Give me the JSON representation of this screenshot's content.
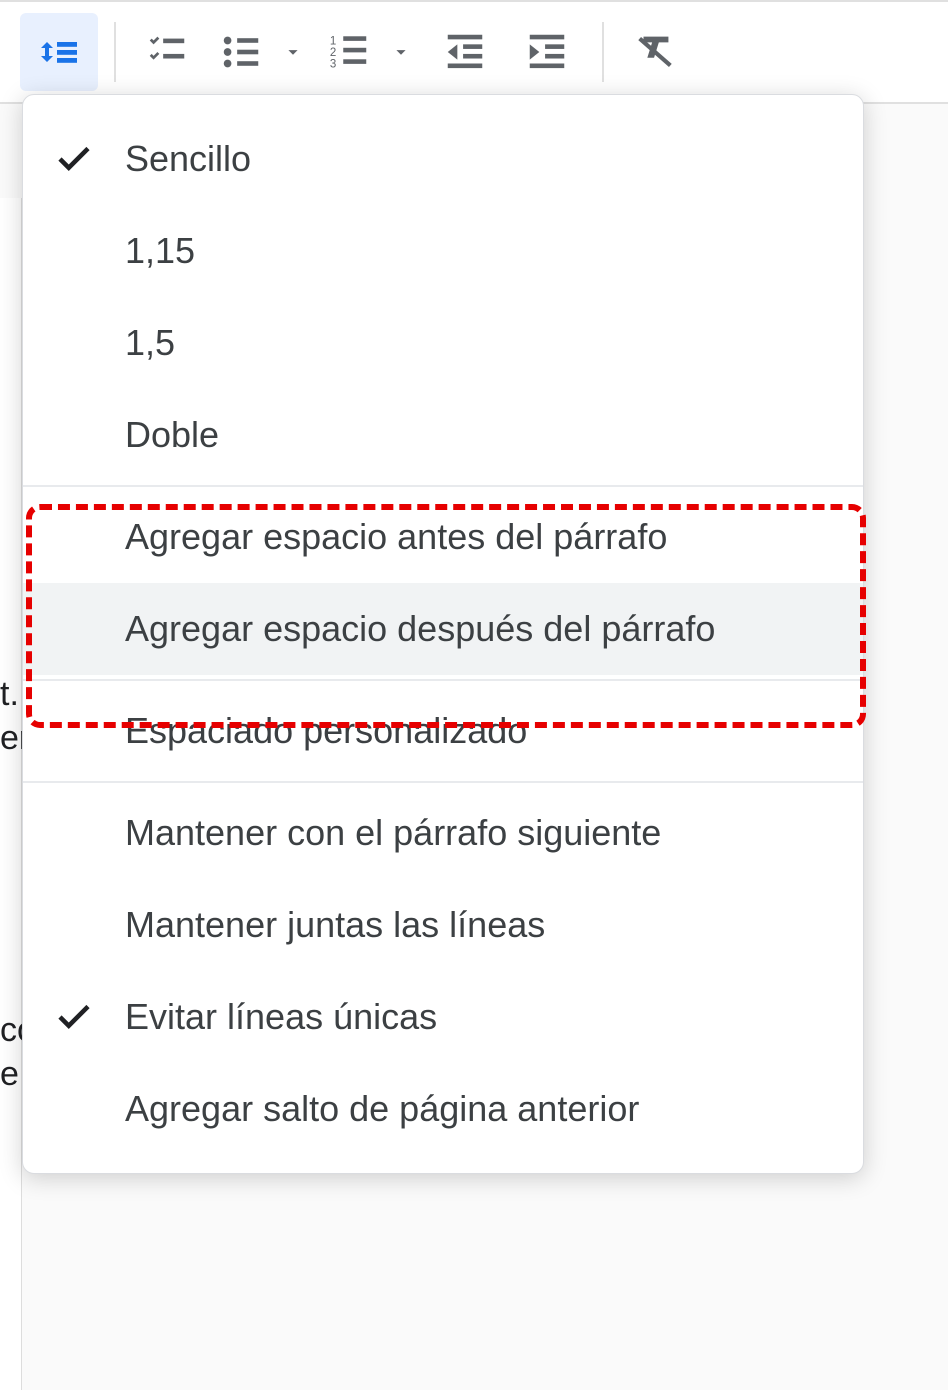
{
  "toolbar": {
    "buttons": [
      {
        "name": "line-spacing",
        "active": true
      },
      {
        "name": "checklist"
      },
      {
        "name": "bulleted-list"
      },
      {
        "name": "numbered-list"
      },
      {
        "name": "decrease-indent"
      },
      {
        "name": "increase-indent"
      },
      {
        "name": "clear-formatting"
      }
    ]
  },
  "menu": {
    "sections": [
      {
        "items": [
          {
            "label": "Sencillo",
            "checked": true
          },
          {
            "label": "1,15",
            "checked": false
          },
          {
            "label": "1,5",
            "checked": false
          },
          {
            "label": "Doble",
            "checked": false
          }
        ]
      },
      {
        "items": [
          {
            "label": "Agregar espacio antes del párrafo",
            "checked": false,
            "highlighted": true
          },
          {
            "label": "Agregar espacio después del párrafo",
            "checked": false,
            "highlighted": true,
            "hover": true
          }
        ]
      },
      {
        "items": [
          {
            "label": "Espaciado personalizado",
            "checked": false
          }
        ]
      },
      {
        "items": [
          {
            "label": "Mantener con el párrafo siguiente",
            "checked": false
          },
          {
            "label": "Mantener juntas las líneas",
            "checked": false
          },
          {
            "label": "Evitar líneas únicas",
            "checked": true
          },
          {
            "label": "Agregar salto de página anterior",
            "checked": false
          }
        ]
      }
    ]
  },
  "bg": {
    "t1": "t.",
    "t2": "er",
    "t3": "co",
    "t4": "e"
  }
}
